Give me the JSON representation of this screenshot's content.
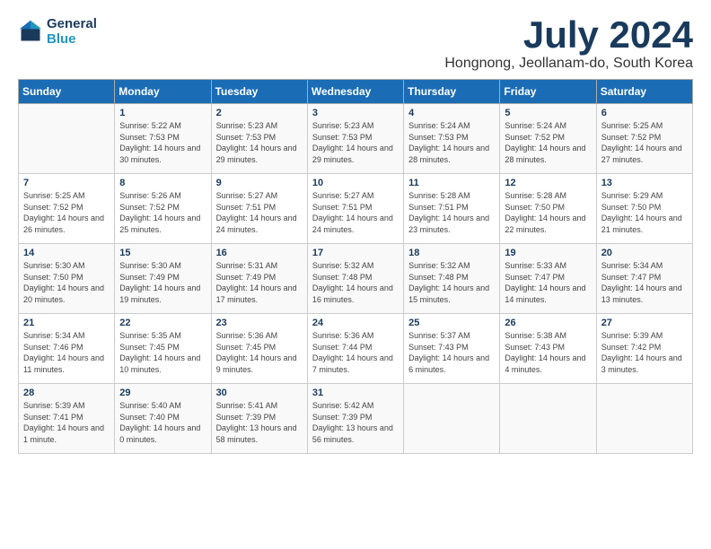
{
  "header": {
    "logo_line1": "General",
    "logo_line2": "Blue",
    "month": "July 2024",
    "location": "Hongnong, Jeollanam-do, South Korea"
  },
  "days_of_week": [
    "Sunday",
    "Monday",
    "Tuesday",
    "Wednesday",
    "Thursday",
    "Friday",
    "Saturday"
  ],
  "weeks": [
    [
      {
        "day": "",
        "sunrise": "",
        "sunset": "",
        "daylight": ""
      },
      {
        "day": "1",
        "sunrise": "Sunrise: 5:22 AM",
        "sunset": "Sunset: 7:53 PM",
        "daylight": "Daylight: 14 hours and 30 minutes."
      },
      {
        "day": "2",
        "sunrise": "Sunrise: 5:23 AM",
        "sunset": "Sunset: 7:53 PM",
        "daylight": "Daylight: 14 hours and 29 minutes."
      },
      {
        "day": "3",
        "sunrise": "Sunrise: 5:23 AM",
        "sunset": "Sunset: 7:53 PM",
        "daylight": "Daylight: 14 hours and 29 minutes."
      },
      {
        "day": "4",
        "sunrise": "Sunrise: 5:24 AM",
        "sunset": "Sunset: 7:53 PM",
        "daylight": "Daylight: 14 hours and 28 minutes."
      },
      {
        "day": "5",
        "sunrise": "Sunrise: 5:24 AM",
        "sunset": "Sunset: 7:52 PM",
        "daylight": "Daylight: 14 hours and 28 minutes."
      },
      {
        "day": "6",
        "sunrise": "Sunrise: 5:25 AM",
        "sunset": "Sunset: 7:52 PM",
        "daylight": "Daylight: 14 hours and 27 minutes."
      }
    ],
    [
      {
        "day": "7",
        "sunrise": "Sunrise: 5:25 AM",
        "sunset": "Sunset: 7:52 PM",
        "daylight": "Daylight: 14 hours and 26 minutes."
      },
      {
        "day": "8",
        "sunrise": "Sunrise: 5:26 AM",
        "sunset": "Sunset: 7:52 PM",
        "daylight": "Daylight: 14 hours and 25 minutes."
      },
      {
        "day": "9",
        "sunrise": "Sunrise: 5:27 AM",
        "sunset": "Sunset: 7:51 PM",
        "daylight": "Daylight: 14 hours and 24 minutes."
      },
      {
        "day": "10",
        "sunrise": "Sunrise: 5:27 AM",
        "sunset": "Sunset: 7:51 PM",
        "daylight": "Daylight: 14 hours and 24 minutes."
      },
      {
        "day": "11",
        "sunrise": "Sunrise: 5:28 AM",
        "sunset": "Sunset: 7:51 PM",
        "daylight": "Daylight: 14 hours and 23 minutes."
      },
      {
        "day": "12",
        "sunrise": "Sunrise: 5:28 AM",
        "sunset": "Sunset: 7:50 PM",
        "daylight": "Daylight: 14 hours and 22 minutes."
      },
      {
        "day": "13",
        "sunrise": "Sunrise: 5:29 AM",
        "sunset": "Sunset: 7:50 PM",
        "daylight": "Daylight: 14 hours and 21 minutes."
      }
    ],
    [
      {
        "day": "14",
        "sunrise": "Sunrise: 5:30 AM",
        "sunset": "Sunset: 7:50 PM",
        "daylight": "Daylight: 14 hours and 20 minutes."
      },
      {
        "day": "15",
        "sunrise": "Sunrise: 5:30 AM",
        "sunset": "Sunset: 7:49 PM",
        "daylight": "Daylight: 14 hours and 19 minutes."
      },
      {
        "day": "16",
        "sunrise": "Sunrise: 5:31 AM",
        "sunset": "Sunset: 7:49 PM",
        "daylight": "Daylight: 14 hours and 17 minutes."
      },
      {
        "day": "17",
        "sunrise": "Sunrise: 5:32 AM",
        "sunset": "Sunset: 7:48 PM",
        "daylight": "Daylight: 14 hours and 16 minutes."
      },
      {
        "day": "18",
        "sunrise": "Sunrise: 5:32 AM",
        "sunset": "Sunset: 7:48 PM",
        "daylight": "Daylight: 14 hours and 15 minutes."
      },
      {
        "day": "19",
        "sunrise": "Sunrise: 5:33 AM",
        "sunset": "Sunset: 7:47 PM",
        "daylight": "Daylight: 14 hours and 14 minutes."
      },
      {
        "day": "20",
        "sunrise": "Sunrise: 5:34 AM",
        "sunset": "Sunset: 7:47 PM",
        "daylight": "Daylight: 14 hours and 13 minutes."
      }
    ],
    [
      {
        "day": "21",
        "sunrise": "Sunrise: 5:34 AM",
        "sunset": "Sunset: 7:46 PM",
        "daylight": "Daylight: 14 hours and 11 minutes."
      },
      {
        "day": "22",
        "sunrise": "Sunrise: 5:35 AM",
        "sunset": "Sunset: 7:45 PM",
        "daylight": "Daylight: 14 hours and 10 minutes."
      },
      {
        "day": "23",
        "sunrise": "Sunrise: 5:36 AM",
        "sunset": "Sunset: 7:45 PM",
        "daylight": "Daylight: 14 hours and 9 minutes."
      },
      {
        "day": "24",
        "sunrise": "Sunrise: 5:36 AM",
        "sunset": "Sunset: 7:44 PM",
        "daylight": "Daylight: 14 hours and 7 minutes."
      },
      {
        "day": "25",
        "sunrise": "Sunrise: 5:37 AM",
        "sunset": "Sunset: 7:43 PM",
        "daylight": "Daylight: 14 hours and 6 minutes."
      },
      {
        "day": "26",
        "sunrise": "Sunrise: 5:38 AM",
        "sunset": "Sunset: 7:43 PM",
        "daylight": "Daylight: 14 hours and 4 minutes."
      },
      {
        "day": "27",
        "sunrise": "Sunrise: 5:39 AM",
        "sunset": "Sunset: 7:42 PM",
        "daylight": "Daylight: 14 hours and 3 minutes."
      }
    ],
    [
      {
        "day": "28",
        "sunrise": "Sunrise: 5:39 AM",
        "sunset": "Sunset: 7:41 PM",
        "daylight": "Daylight: 14 hours and 1 minute."
      },
      {
        "day": "29",
        "sunrise": "Sunrise: 5:40 AM",
        "sunset": "Sunset: 7:40 PM",
        "daylight": "Daylight: 14 hours and 0 minutes."
      },
      {
        "day": "30",
        "sunrise": "Sunrise: 5:41 AM",
        "sunset": "Sunset: 7:39 PM",
        "daylight": "Daylight: 13 hours and 58 minutes."
      },
      {
        "day": "31",
        "sunrise": "Sunrise: 5:42 AM",
        "sunset": "Sunset: 7:39 PM",
        "daylight": "Daylight: 13 hours and 56 minutes."
      },
      {
        "day": "",
        "sunrise": "",
        "sunset": "",
        "daylight": ""
      },
      {
        "day": "",
        "sunrise": "",
        "sunset": "",
        "daylight": ""
      },
      {
        "day": "",
        "sunrise": "",
        "sunset": "",
        "daylight": ""
      }
    ]
  ]
}
